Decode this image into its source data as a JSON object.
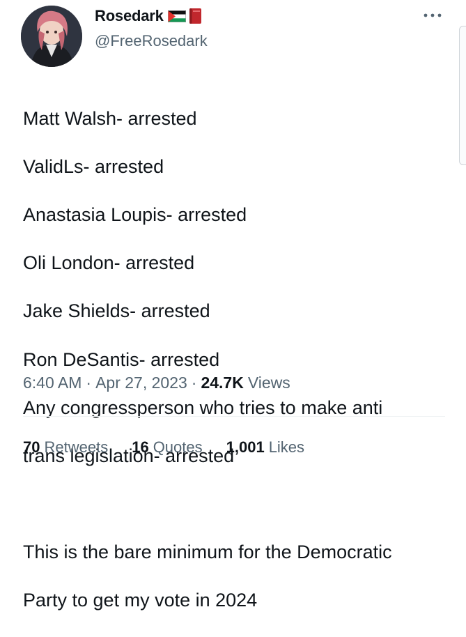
{
  "author": {
    "display_name": "Rosedark",
    "handle": "@FreeRosedark",
    "badges": [
      "palestine-flag-icon",
      "red-book-icon"
    ]
  },
  "tweet": {
    "lines": [
      "Matt Walsh- arrested",
      "ValidLs- arrested",
      "Anastasia Loupis- arrested",
      "Oli London- arrested",
      "Jake Shields- arrested",
      "Ron DeSantis- arrested",
      "Any congressperson who tries to make anti",
      "trans legislation- arrested",
      "",
      "This is the bare minimum for the Democratic",
      "Party to get my vote in 2024"
    ]
  },
  "meta": {
    "time": "6:40 AM",
    "date": "Apr 27, 2023",
    "views_count": "24.7K",
    "views_label": "Views",
    "separator": "·"
  },
  "stats": [
    {
      "count": "70",
      "label": "Retweets"
    },
    {
      "count": "16",
      "label": "Quotes"
    },
    {
      "count": "1,001",
      "label": "Likes"
    }
  ]
}
